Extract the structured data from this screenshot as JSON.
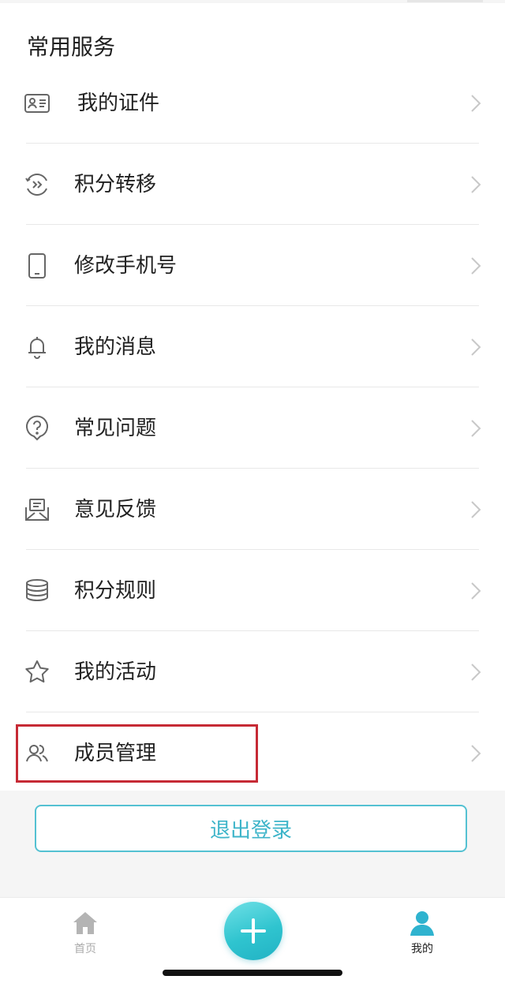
{
  "section": {
    "title": "常用服务"
  },
  "menu": [
    {
      "label": "我的证件",
      "icon": "id-card-icon"
    },
    {
      "label": "积分转移",
      "icon": "transfer-icon"
    },
    {
      "label": "修改手机号",
      "icon": "phone-icon"
    },
    {
      "label": "我的消息",
      "icon": "bell-icon"
    },
    {
      "label": "常见问题",
      "icon": "question-icon"
    },
    {
      "label": "意见反馈",
      "icon": "feedback-icon"
    },
    {
      "label": "积分规则",
      "icon": "coins-stack-icon"
    },
    {
      "label": "我的活动",
      "icon": "star-icon"
    },
    {
      "label": "成员管理",
      "icon": "members-icon"
    }
  ],
  "logout": {
    "label": "退出登录"
  },
  "tabbar": {
    "home_label": "首页",
    "mine_label": "我的",
    "add_icon": "plus-icon"
  },
  "colors": {
    "accent": "#3db4c9",
    "highlight": "#c62a35",
    "icon_gray": "#666666",
    "chevron": "#c8c8c8"
  }
}
